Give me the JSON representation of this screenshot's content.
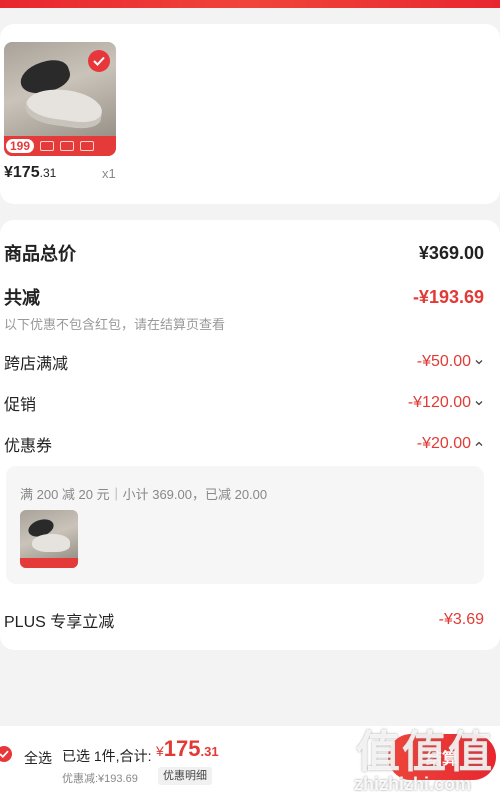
{
  "product": {
    "promo_price": "199",
    "price_currency": "¥",
    "price_integer": "175",
    "price_decimal": ".31",
    "quantity": "x1",
    "selected": true
  },
  "summary": {
    "total_label": "商品总价",
    "total_value": "¥369.00",
    "discount_label": "共减",
    "discount_value": "-¥193.69",
    "discount_note": "以下优惠不包含红包，请在结算页查看",
    "items": [
      {
        "label": "跨店满减",
        "value": "-¥50.00",
        "expanded": false
      },
      {
        "label": "促销",
        "value": "-¥120.00",
        "expanded": false
      },
      {
        "label": "优惠券",
        "value": "-¥20.00",
        "expanded": true
      }
    ],
    "coupon_detail": "满 200 减 20 元｜小计 369.00，已减 20.00",
    "plus_label": "PLUS 专享立减",
    "plus_value": "-¥3.69"
  },
  "bottom_bar": {
    "select_all_label": "全选",
    "selected_text": "已选 1件,合计:",
    "sum_currency": "¥",
    "sum_integer": "175",
    "sum_decimal": ".31",
    "discount_text": "优惠减:¥193.69",
    "detail_button": "优惠明细",
    "checkout_button": "结算"
  },
  "watermark": {
    "main": "值值值",
    "sub": "zhizhizhi.com"
  },
  "colors": {
    "accent": "#e8373a",
    "price_red": "#e23a35"
  }
}
